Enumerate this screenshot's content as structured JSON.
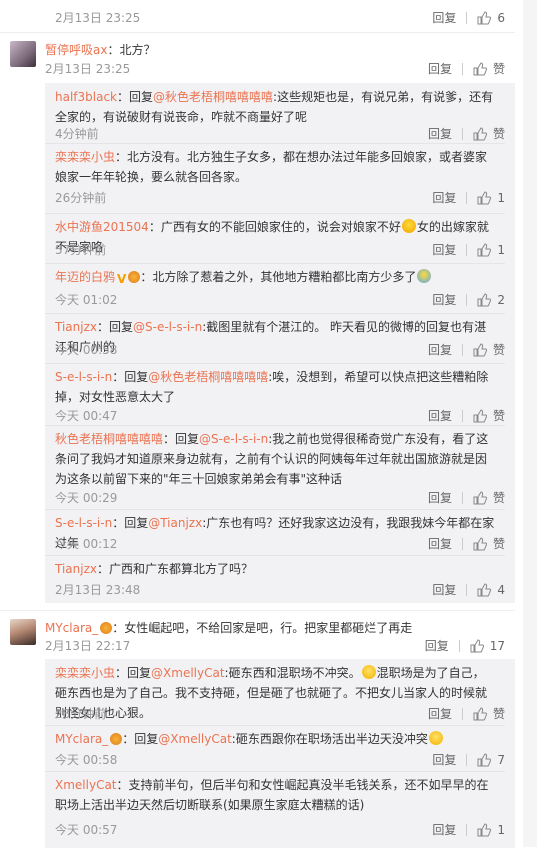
{
  "common": {
    "reply": "回复",
    "like": "赞"
  },
  "top": {
    "date": "2月13日 23:25",
    "likes": "6"
  },
  "c1": {
    "user": "暂停呼吸ax",
    "text": "：北方？",
    "date": "2月13日 23:25"
  },
  "c1r": [
    {
      "user": "half3black",
      "pre": "：回复",
      "mention": "@秋色老梧桐嘻嘻嘻嘻",
      "text": ":这些规矩也是，有说兄弟，有说爹，还有全家的，有说破财有说丧命，咋就不商量好了呢",
      "date": "4分钟前",
      "likes": "赞"
    },
    {
      "user": "栾栾栾小虫",
      "text": "：北方没有。北方独生子女多，都在想办法过年能多回娘家，或者婆家娘家一年年轮换，要么就各回各家。",
      "date": "26分钟前",
      "likes": "1"
    },
    {
      "user": "水中游鱼201504",
      "text_a": "：广西有女的不能回娘家住的，说会对娘家不好",
      "text_b": "女的出嫁家就不是家咯",
      "date": "57分钟前",
      "likes": "1"
    },
    {
      "user": "年迈的白鸦",
      "text": "：北方除了惹着之外，其他地方糟粕都比南方少多了",
      "date": "今天 01:02",
      "likes": "2"
    },
    {
      "user": "Tianjzx",
      "pre": "：回复",
      "mention": "@S-e-l-s-i-n",
      "text": ":截图里就有个湛江的。  昨天看见的微博的回复也有湛江和广州的",
      "date": "今天 00:58",
      "likes": "赞"
    },
    {
      "user": "S-e-l-s-i-n",
      "pre": "：回复",
      "mention": "@秋色老梧桐嘻嘻嘻嘻",
      "text": ":唉，没想到，希望可以快点把这些糟粕除掉，对女性恶意太大了",
      "date": "今天 00:47",
      "likes": "赞"
    },
    {
      "user": "秋色老梧桐嘻嘻嘻嘻",
      "pre": "：回复",
      "mention": "@S-e-l-s-i-n",
      "text": ":我之前也觉得很稀奇觉广东没有，看了这条问了我妈才知道原来身边就有，之前有个认识的阿姨每年过年就出国旅游就是因为这条以前留下来的\"年三十回娘家弟弟会有事\"这种话",
      "date": "今天 00:29",
      "likes": "赞"
    },
    {
      "user": "S-e-l-s-i-n",
      "pre": "：回复",
      "mention": "@Tianjzx",
      "text": ":广东也有吗？还好我家这边没有，我跟我妹今年都在家过年",
      "date": "今天 00:12",
      "likes": "赞"
    },
    {
      "user": "Tianjzx",
      "text": "：广西和广东都算北方了吗？",
      "date": "2月13日 23:48",
      "likes": "4"
    }
  ],
  "c2": {
    "user": "MYclara_",
    "text": "：女性崛起吧，不给回家是吧，行。把家里都砸烂了再走",
    "date": "2月13日 22:17",
    "likes": "17"
  },
  "c2r": [
    {
      "user": "栾栾栾小虫",
      "pre": "：回复",
      "mention": "@XmellyCat",
      "text_a": ":砸东西和混职场不冲突。",
      "text_b": "混职场是为了自己，砸东西也是为了自己。我不支持砸，但是砸了也就砸了。不把女儿当家人的时候就别怪女儿也心狠。",
      "date": "28分钟前",
      "likes": "赞"
    },
    {
      "user": "MYclara_",
      "pre": "：回复",
      "mention": "@XmellyCat",
      "text": ":砸东西跟你在职场活出半边天没冲突",
      "date": "今天 00:58",
      "likes": "7"
    },
    {
      "user": "XmellyCat",
      "text": "：支持前半句，但后半句和女性崛起真没半毛钱关系，还不如早早的在职场上活出半边天然后切断联系(如果原生家庭太糟糕的话)",
      "date": "今天 00:57",
      "likes": "1"
    }
  ]
}
